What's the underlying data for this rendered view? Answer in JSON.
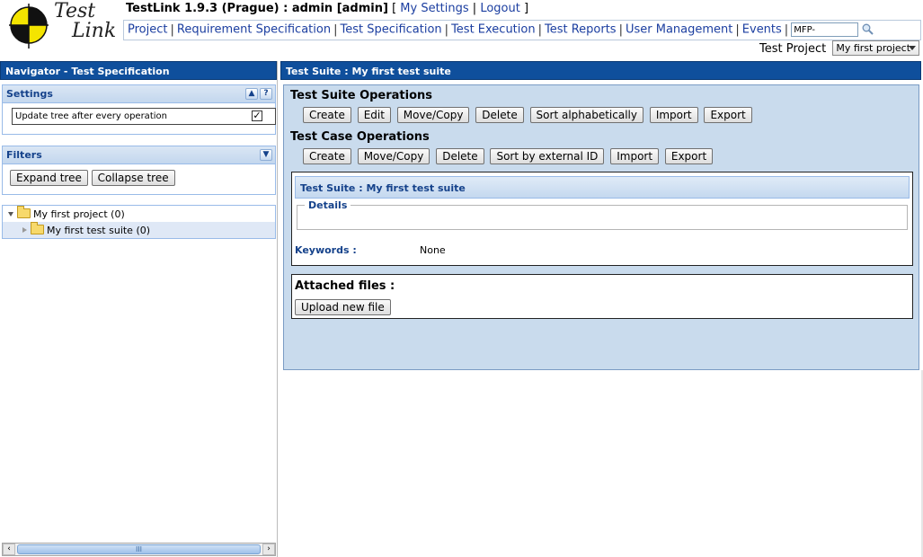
{
  "header": {
    "logo_line1": "Test",
    "logo_line2": "Link",
    "app_title": "TestLink 1.9.3 (Prague) : admin [admin]",
    "bracket_open": "[",
    "bracket_close": "]",
    "link_sep": "|",
    "my_settings": "My Settings",
    "logout": "Logout",
    "menu": [
      "Project",
      "Requirement Specification",
      "Test Specification",
      "Test Execution",
      "Test Reports",
      "User Management",
      "Events"
    ],
    "menu_sep": "|",
    "search_value": "MFP-",
    "search_icon": "magnifier-icon",
    "test_project_label": "Test Project",
    "test_project_selected": "My first project"
  },
  "navigator": {
    "title": "Navigator - Test Specification",
    "settings": {
      "title": "Settings",
      "collapse_glyph": "▲",
      "help_glyph": "?",
      "update_tree_label": "Update tree after every operation",
      "update_tree_checked_glyph": "✓"
    },
    "filters": {
      "title": "Filters",
      "expand_glyph": "▼",
      "expand_tree": "Expand tree",
      "collapse_tree": "Collapse tree"
    },
    "tree": {
      "root": "My first project (0)",
      "child": "My first test suite (0)"
    },
    "scroll_grip": "III",
    "scroll_left": "‹",
    "scroll_right": "›"
  },
  "main": {
    "title": "Test Suite : My first test suite",
    "suite_ops_heading": "Test Suite Operations",
    "suite_ops": [
      "Create",
      "Edit",
      "Move/Copy",
      "Delete",
      "Sort alphabetically",
      "Import",
      "Export"
    ],
    "case_ops_heading": "Test Case Operations",
    "case_ops": [
      "Create",
      "Move/Copy",
      "Delete",
      "Sort by external ID",
      "Import",
      "Export"
    ],
    "suite_box": {
      "title": "Test Suite : My first test suite",
      "details_legend": "Details",
      "keywords_label": "Keywords :",
      "keywords_value": "None"
    },
    "attachments": {
      "title": "Attached files :",
      "upload_button": "Upload new file"
    }
  },
  "colors": {
    "pane_title_bg": "#0f4f9c",
    "ops_area_bg": "#c9dbed",
    "link": "#1b3ea0",
    "panel_title_text": "#15428b"
  }
}
